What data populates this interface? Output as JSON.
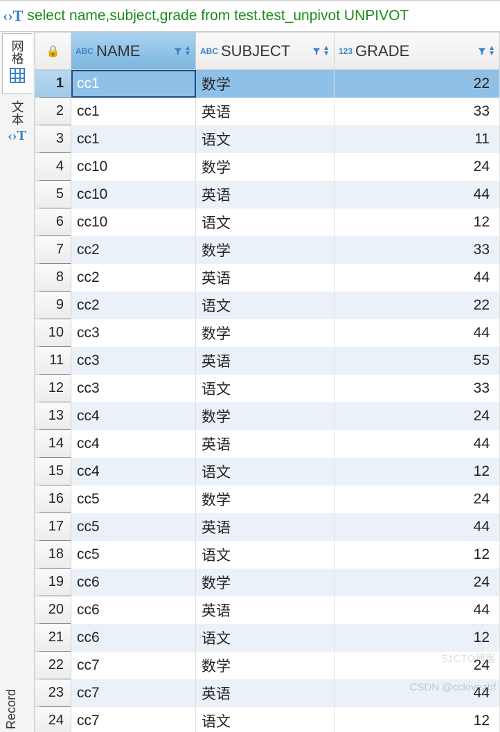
{
  "sql": {
    "icon": "‹›T",
    "query": "select name,subject,grade from test.test_unpivot UNPIVOT"
  },
  "side_tabs": {
    "grid": "网格",
    "text": "文本",
    "record": "Record"
  },
  "columns": {
    "name": {
      "type": "ABC",
      "label": "NAME"
    },
    "subject": {
      "type": "ABC",
      "label": "SUBJECT"
    },
    "grade": {
      "type": "123",
      "label": "GRADE"
    }
  },
  "rows": [
    {
      "n": "1",
      "name": "cc1",
      "subject": "数学",
      "grade": "22"
    },
    {
      "n": "2",
      "name": "cc1",
      "subject": "英语",
      "grade": "33"
    },
    {
      "n": "3",
      "name": "cc1",
      "subject": "语文",
      "grade": "11"
    },
    {
      "n": "4",
      "name": "cc10",
      "subject": "数学",
      "grade": "24"
    },
    {
      "n": "5",
      "name": "cc10",
      "subject": "英语",
      "grade": "44"
    },
    {
      "n": "6",
      "name": "cc10",
      "subject": "语文",
      "grade": "12"
    },
    {
      "n": "7",
      "name": "cc2",
      "subject": "数学",
      "grade": "33"
    },
    {
      "n": "8",
      "name": "cc2",
      "subject": "英语",
      "grade": "44"
    },
    {
      "n": "9",
      "name": "cc2",
      "subject": "语文",
      "grade": "22"
    },
    {
      "n": "10",
      "name": "cc3",
      "subject": "数学",
      "grade": "44"
    },
    {
      "n": "11",
      "name": "cc3",
      "subject": "英语",
      "grade": "55"
    },
    {
      "n": "12",
      "name": "cc3",
      "subject": "语文",
      "grade": "33"
    },
    {
      "n": "13",
      "name": "cc4",
      "subject": "数学",
      "grade": "24"
    },
    {
      "n": "14",
      "name": "cc4",
      "subject": "英语",
      "grade": "44"
    },
    {
      "n": "15",
      "name": "cc4",
      "subject": "语文",
      "grade": "12"
    },
    {
      "n": "16",
      "name": "cc5",
      "subject": "数学",
      "grade": "24"
    },
    {
      "n": "17",
      "name": "cc5",
      "subject": "英语",
      "grade": "44"
    },
    {
      "n": "18",
      "name": "cc5",
      "subject": "语文",
      "grade": "12"
    },
    {
      "n": "19",
      "name": "cc6",
      "subject": "数学",
      "grade": "24"
    },
    {
      "n": "20",
      "name": "cc6",
      "subject": "英语",
      "grade": "44"
    },
    {
      "n": "21",
      "name": "cc6",
      "subject": "语文",
      "grade": "12"
    },
    {
      "n": "22",
      "name": "cc7",
      "subject": "数学",
      "grade": "24"
    },
    {
      "n": "23",
      "name": "cc7",
      "subject": "英语",
      "grade": "44"
    },
    {
      "n": "24",
      "name": "cc7",
      "subject": "语文",
      "grade": "12"
    }
  ],
  "watermarks": {
    "csdn": "CSDN @cclovezbf",
    "cto": "51CTO博客"
  }
}
